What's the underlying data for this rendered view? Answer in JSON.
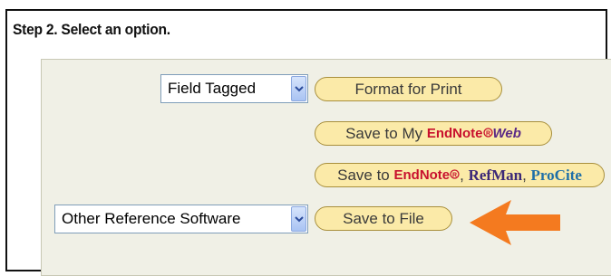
{
  "step": {
    "title": "Step 2. Select an option."
  },
  "format_select": {
    "value": "Field Tagged"
  },
  "software_select": {
    "value": "Other Reference Software"
  },
  "buttons": {
    "format_print": "Format for Print",
    "save_my_prefix": "Save to My ",
    "save_to_prefix": "Save to ",
    "endnote": "EndNote",
    "web": "Web",
    "refman": "RefMan",
    "procite": "ProCite",
    "save_file": "Save to File"
  },
  "icons": {
    "dropdown": "chevron-down-icon",
    "pointer": "arrow-left-icon"
  },
  "colors": {
    "button_fill": "#fbeaa8",
    "button_border": "#a88f3c",
    "endnote_red": "#c8102e",
    "arrow_orange": "#f47a1f",
    "panel_bg": "#f0f0e6"
  }
}
